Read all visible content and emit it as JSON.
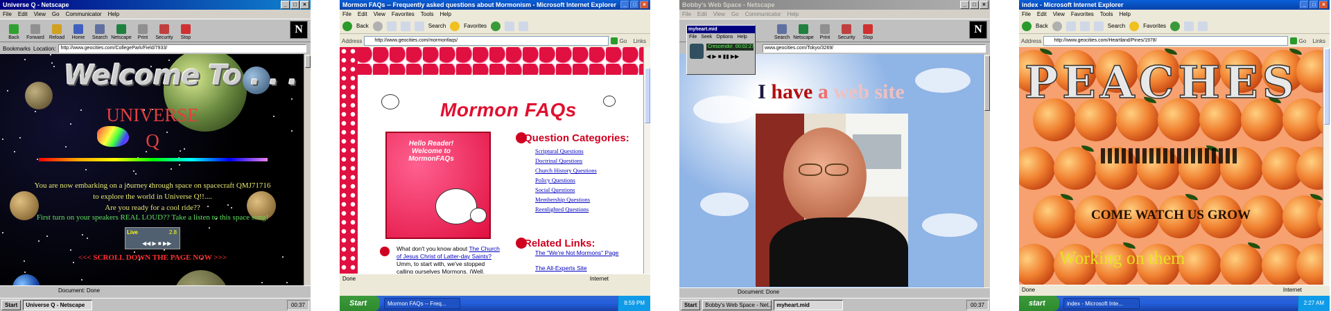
{
  "panel1": {
    "window_title": "Universe Q - Netscape",
    "menu": [
      "File",
      "Edit",
      "View",
      "Go",
      "Communicator",
      "Help"
    ],
    "toolbar": [
      "Back",
      "Forward",
      "Reload",
      "Home",
      "Search",
      "Netscape",
      "Print",
      "Security",
      "Stop"
    ],
    "bookmarks_label": "Bookmarks",
    "location_label": "Location:",
    "url": "http://www.geocities.com/CollegePark/Field/7933/",
    "heading": "Welcome To . . .",
    "title_line1": "UNIVERSE",
    "title_line2": "Q",
    "text1": "You are now embarking on a journey through space on spacecraft QMJ71716",
    "text2": "to explore the world in Universe Q!!....",
    "text3": "Are you ready for a cool ride??",
    "text4": "First turn on your speakers REAL LOUD?? Take a listen to this space song!",
    "scroll_msg": "<<< SCROLL DOWN THE PAGE NOW >>>",
    "player_label": "Live",
    "player_time": "2.8",
    "status": "Document: Done",
    "start": "Start",
    "task": "Universe Q - Netscape",
    "clock": "00:37"
  },
  "panel2": {
    "window_title": "Mormon FAQs -- Frequently asked questions about Mormonism - Microsoft Internet Explorer",
    "menu": [
      "File",
      "Edit",
      "View",
      "Favorites",
      "Tools",
      "Help"
    ],
    "back": "Back",
    "search": "Search",
    "favorites": "Favorites",
    "address_label": "Address",
    "url": "http://www.geocities.com/mormonfaqs/",
    "go": "Go",
    "links": "Links",
    "page_title": "Mormon FAQs",
    "hello_text": "Hello Reader! Welcome to MormonFAQs",
    "question_header": "Question Categories:",
    "questions": [
      "Scriptural Questions",
      "Doctrinal Questions",
      "Church History Questions",
      "Policy Questions",
      "Social Questions",
      "Membership Questions",
      "Reenlighted Questions"
    ],
    "related_header": "Related Links:",
    "related": [
      "The \"We're Not Mormons\" Page",
      "The All-Experts Site"
    ],
    "intro_prefix": "What don't you know about ",
    "intro_link": "The Church of Jesus Christ of Latter-day Saints?",
    "intro_rest": "Umm, to start with, we've stopped calling ourselves Mormons. (Well, mostly.) Our",
    "status": "Done",
    "zone": "Internet",
    "start": "Start",
    "task": "Mormon FAQs -- Freq...",
    "clock": "8:59 PM"
  },
  "panel3": {
    "window_title": "Bobby's Web Space - Netscape",
    "menu": [
      "File",
      "Edit",
      "View",
      "Go",
      "Communicator",
      "Help"
    ],
    "mini_title": "myheart.mid",
    "mini_menu": [
      "File",
      "Seek",
      "Options",
      "Help"
    ],
    "mini_song": "Crescendo!",
    "mini_time": "00:02:27",
    "toolbar": [
      "Search",
      "Netscape",
      "Print",
      "Security",
      "Stop"
    ],
    "url": "www.geocities.com/Tokyo/3269/",
    "heading_i": "I",
    "heading_have": "have",
    "heading_a": "a",
    "heading_rest": "web site",
    "status": "Document: Done",
    "start": "Start",
    "task1": "Bobby's Web Space - Net...",
    "task2": "myheart.mid",
    "clock": "00:37",
    "colors": {
      "have": "#b01010",
      "a": "#f07070",
      "rest": "#f0c0c0"
    }
  },
  "panel4": {
    "window_title": "index - Microsoft Internet Explorer",
    "menu": [
      "File",
      "Edit",
      "View",
      "Favorites",
      "Tools",
      "Help"
    ],
    "back": "Back",
    "search": "Search",
    "favorites": "Favorites",
    "address_label": "Address",
    "url": "http://www.geocities.com/Heartland/Pines/1978/",
    "go": "Go",
    "links": "Links",
    "title": "PEACHES",
    "subtitle": "COME WATCH US GROW",
    "working": "Working  on them",
    "status": "Done",
    "zone": "Internet",
    "start": "start",
    "task": "index - Microsoft Inte...",
    "clock": "2:27 AM"
  }
}
